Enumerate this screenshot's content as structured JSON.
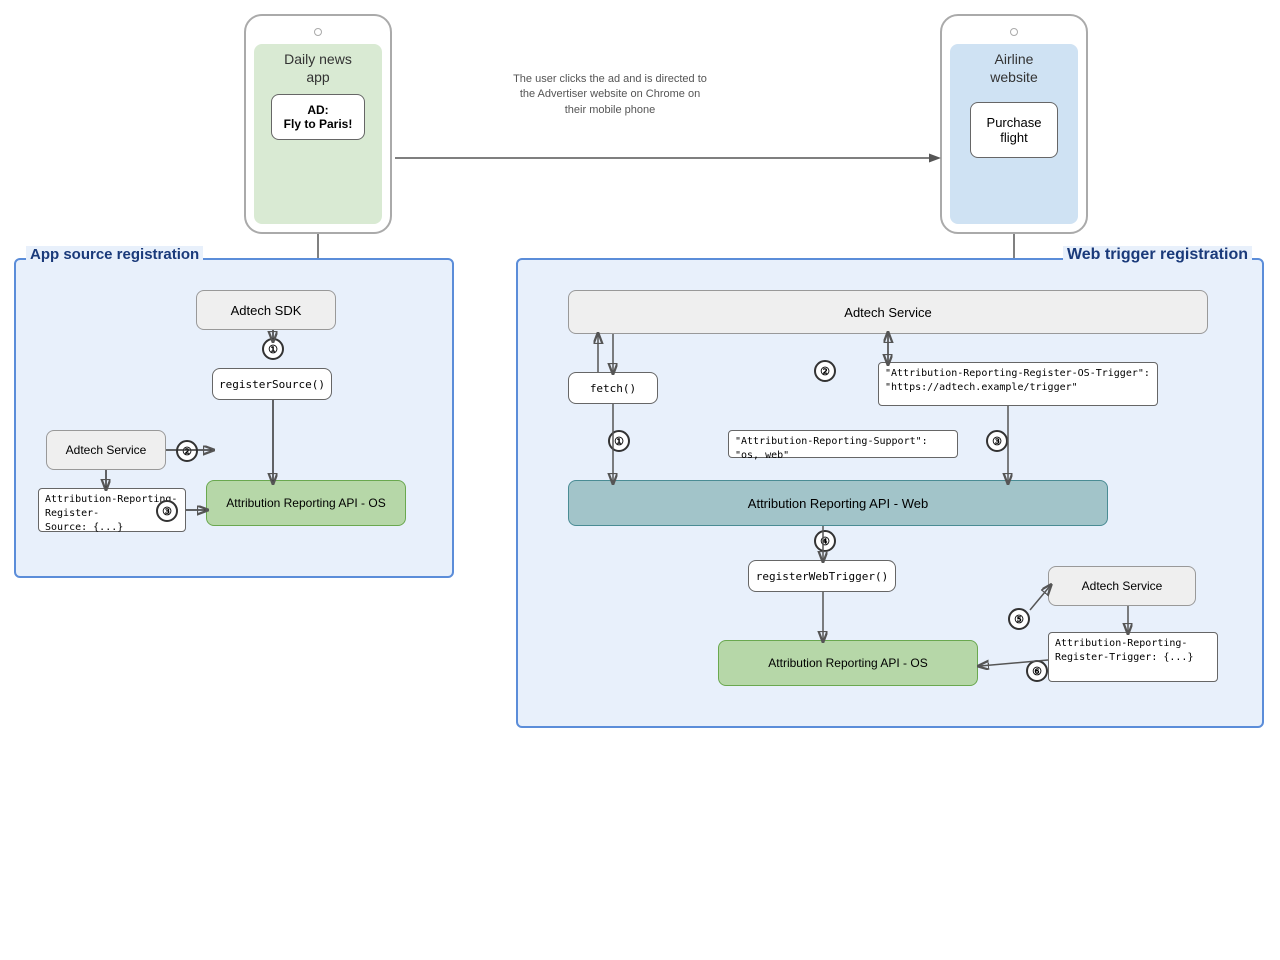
{
  "phones": {
    "left": {
      "title": "Daily news\napp",
      "ad_label": "AD:\nFly to Paris!",
      "color": "green"
    },
    "right": {
      "title": "Airline\nwebsite",
      "purchase_label": "Purchase\nflight",
      "color": "blue"
    }
  },
  "arrow_annotation": "The user clicks the ad and is directed to\nthe Advertiser website on Chrome on\ntheir mobile phone",
  "left_box": {
    "title": "App source registration",
    "elements": {
      "adtech_sdk": "Adtech SDK",
      "register_source": "registerSource()",
      "adtech_service": "Adtech Service",
      "attribution_api_os": "Attribution Reporting API - OS",
      "code_block": "Attribution-Reporting-Register-\nSource: {...}",
      "step1": "①",
      "step2": "②",
      "step3": "③"
    }
  },
  "right_box": {
    "title": "Web trigger registration",
    "elements": {
      "adtech_service_top": "Adtech Service",
      "fetch": "fetch()",
      "os_trigger_code": "\"Attribution-Reporting-Register-OS-Trigger\":\n\"https://adtech.example/trigger\"",
      "support_code": "\"Attribution-Reporting-Support\": \"os, web\"",
      "attribution_api_web": "Attribution Reporting API - Web",
      "register_web_trigger": "registerWebTrigger()",
      "adtech_service_bottom": "Adtech Service",
      "attribution_api_os": "Attribution Reporting API - OS",
      "code_block_bottom": "Attribution-Reporting-\nRegister-Trigger: {...}",
      "step1": "①",
      "step2": "②",
      "step3": "③",
      "step4": "④",
      "step5": "⑤",
      "step6": "⑥"
    }
  }
}
